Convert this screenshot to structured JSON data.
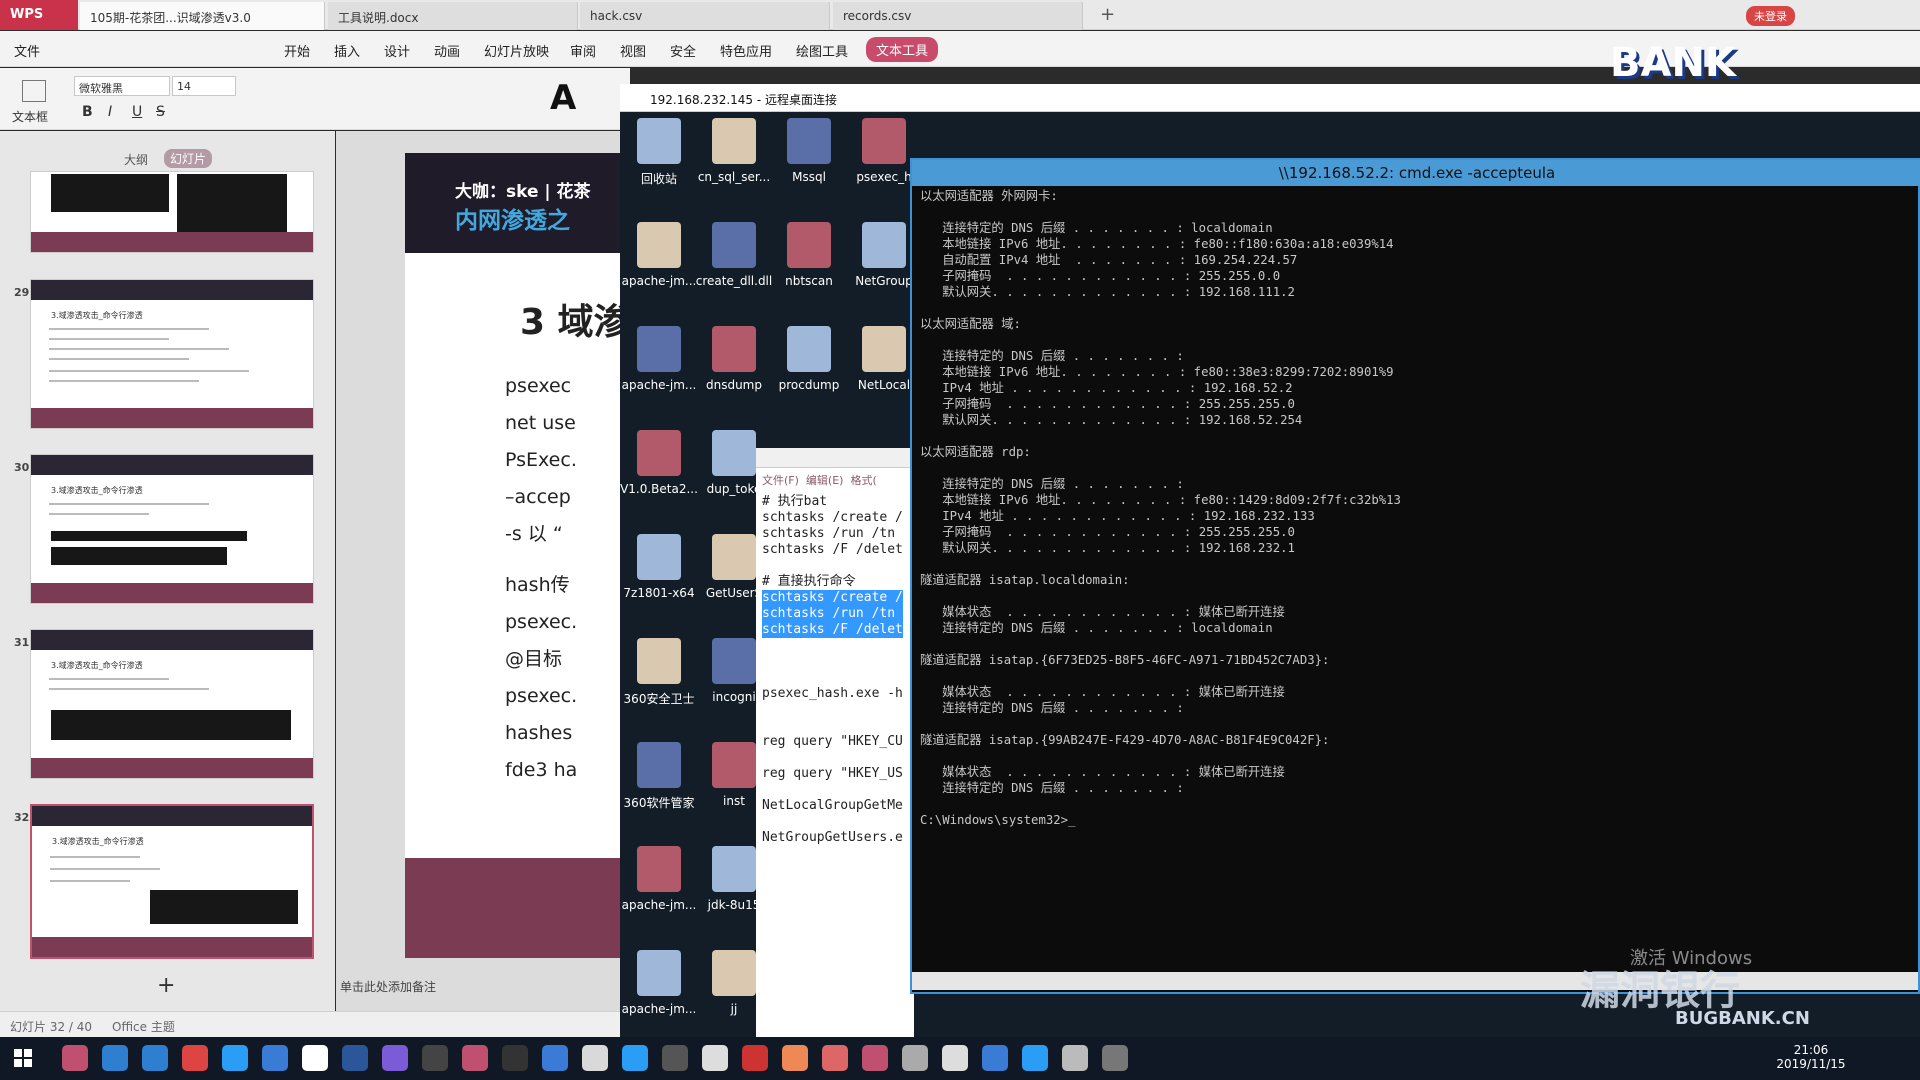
{
  "tabs": {
    "wps": "WPS",
    "t1": "105期-花茶团...识域渗透v3.0",
    "t2": "工具说明.docx",
    "t3": "hack.csv",
    "t4": "records.csv",
    "new": "+",
    "login": "未登录"
  },
  "menu": [
    "文件",
    "开始",
    "插入",
    "设计",
    "动画",
    "幻灯片放映",
    "审阅",
    "视图",
    "安全",
    "特色应用",
    "绘图工具",
    "文本工具"
  ],
  "toolbar": {
    "textbox": "文本框",
    "font": "微软雅黑",
    "size": "14",
    "bold": "B",
    "italic": "I",
    "underline": "U",
    "strike": "S",
    "bigA": "A"
  },
  "leftpane": {
    "tab_outline": "大纲",
    "tab_slides": "幻灯片",
    "nums": [
      "29",
      "30",
      "31",
      "32"
    ],
    "slide_title": "3.域渗透攻击_命令行渗透",
    "add": "+"
  },
  "slide": {
    "header1": "大咖：ske | 花茶",
    "header2": "内网渗透之",
    "title": "3 域渗",
    "bullets": [
      "psexec",
      "net use",
      "PsExec.",
      "–accep",
      "-s 以 “",
      "hash传",
      "psexec.",
      "@目标",
      "psexec.",
      "hashes",
      "fde3 ha"
    ]
  },
  "status": {
    "slides": "幻灯片 32 / 40",
    "theme": "Office 主题",
    "notes": "单击此处添加备注"
  },
  "rdp": {
    "title": "192.168.232.145 - 远程桌面连接"
  },
  "desktop_icons": [
    [
      "回收站",
      "cn_sql_ser...",
      "Mssql",
      "psexec_h"
    ],
    [
      "apache-jm...",
      "create_dll.dll",
      "nbtscan",
      "NetGroup"
    ],
    [
      "apache-jm...",
      "dnsdump",
      "procdump",
      "NetLocal"
    ],
    [
      "V1.0.Beta2...",
      "dup_toke"
    ],
    [
      "7z1801-x64",
      "GetUserS"
    ],
    [
      "360安全卫士",
      "incogni"
    ],
    [
      "360软件管家",
      "inst"
    ],
    [
      "apache-jm...",
      "jdk-8u15"
    ],
    [
      "apache-jm...",
      "jj"
    ]
  ],
  "notepad": {
    "menu": [
      "文件(F)",
      "编辑(E)",
      "格式("
    ],
    "lines": [
      "# 执行bat",
      "schtasks /create /",
      "schtasks /run /tn",
      "schtasks /F /delet",
      "",
      "# 直接执行命令",
      "schtasks /create /",
      "schtasks /run /tn",
      "schtasks /F /delet",
      "",
      "",
      "",
      "psexec_hash.exe -h",
      "",
      "",
      "reg query \"HKEY_CU",
      "",
      "reg query \"HKEY_US",
      "",
      "NetLocalGroupGetMe",
      "",
      "NetGroupGetUsers.e"
    ]
  },
  "cmd": {
    "title": "\\\\192.168.52.2: cmd.exe -accepteula",
    "text": "以太网适配器 外网网卡:\n\n   连接特定的 DNS 后缀 . . . . . . . : localdomain\n   本地链接 IPv6 地址. . . . . . . . : fe80::f180:630a:a18:e039%14\n   自动配置 IPv4 地址  . . . . . . . : 169.254.224.57\n   子网掩码  . . . . . . . . . . . . : 255.255.0.0\n   默认网关. . . . . . . . . . . . . : 192.168.111.2\n\n以太网适配器 域:\n\n   连接特定的 DNS 后缀 . . . . . . . :\n   本地链接 IPv6 地址. . . . . . . . : fe80::38e3:8299:7202:8901%9\n   IPv4 地址 . . . . . . . . . . . . : 192.168.52.2\n   子网掩码  . . . . . . . . . . . . : 255.255.255.0\n   默认网关. . . . . . . . . . . . . : 192.168.52.254\n\n以太网适配器 rdp:\n\n   连接特定的 DNS 后缀 . . . . . . . :\n   本地链接 IPv6 地址. . . . . . . . : fe80::1429:8d09:2f7f:c32b%13\n   IPv4 地址 . . . . . . . . . . . . : 192.168.232.133\n   子网掩码  . . . . . . . . . . . . : 255.255.255.0\n   默认网关. . . . . . . . . . . . . : 192.168.232.1\n\n隧道适配器 isatap.localdomain:\n\n   媒体状态  . . . . . . . . . . . . : 媒体已断开连接\n   连接特定的 DNS 后缀 . . . . . . . : localdomain\n\n隧道适配器 isatap.{6F73ED25-B8F5-46FC-A971-71BD452C7AD3}:\n\n   媒体状态  . . . . . . . . . . . . : 媒体已断开连接\n   连接特定的 DNS 后缀 . . . . . . . :\n\n隧道适配器 isatap.{99AB247E-F429-4D70-A8AC-B81F4E9C042F}:\n\n   媒体状态  . . . . . . . . . . . . : 媒体已断开连接\n   连接特定的 DNS 后缀 . . . . . . . :\n\nC:\\Windows\\system32>_"
  },
  "overlay": {
    "brand": "BANK",
    "activate": "激活 Windows",
    "watermark": "漏洞银行",
    "watermark2": "BUGBANK.CN"
  },
  "taskbar": {
    "time": "21:06",
    "date": "2019/11/15"
  }
}
